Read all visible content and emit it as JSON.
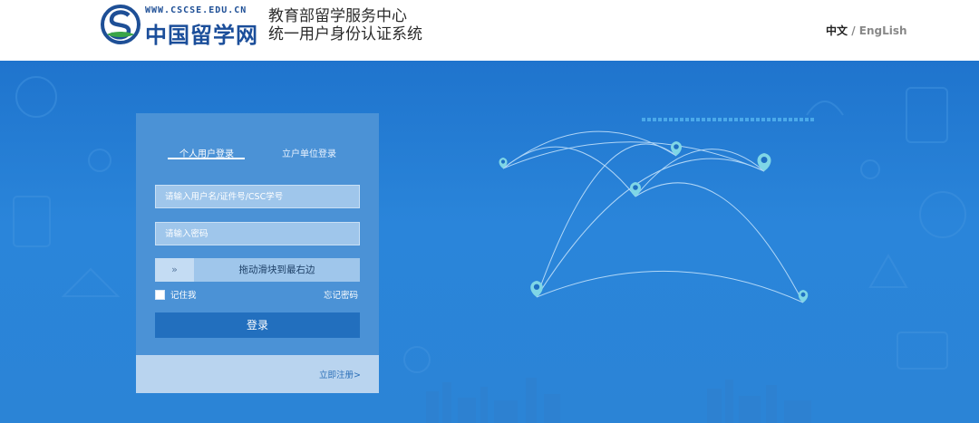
{
  "header": {
    "logo": {
      "url_text": "WWW.CSCSE.EDU.CN",
      "name": "中国留学网"
    },
    "org_title_line1": "教育部留学服务中心",
    "org_title_line2": "统一用户身份认证系统",
    "language": {
      "current": "中文",
      "separator": " / ",
      "other": "EngLish"
    }
  },
  "login": {
    "tabs": [
      {
        "label": "个人用户登录",
        "active": true
      },
      {
        "label": "立户单位登录",
        "active": false
      }
    ],
    "username_placeholder": "请输入用户名/证件号/CSC学号",
    "password_placeholder": "请输入密码",
    "slider": {
      "handle_icon": "»",
      "text": "拖动滑块到最右边"
    },
    "remember_label": "记住我",
    "forgot_label": "忘记密码",
    "submit_label": "登录",
    "register_label": "立即注册>"
  },
  "colors": {
    "accent": "#226fbe",
    "background": "#2a85da",
    "panel": "#4b92d6",
    "pin": "#7fd6e6"
  },
  "icons": {
    "logo": "cscse-logo-icon",
    "map_pin": "map-pin-icon",
    "slider_handle": "double-chevron-right-icon"
  }
}
